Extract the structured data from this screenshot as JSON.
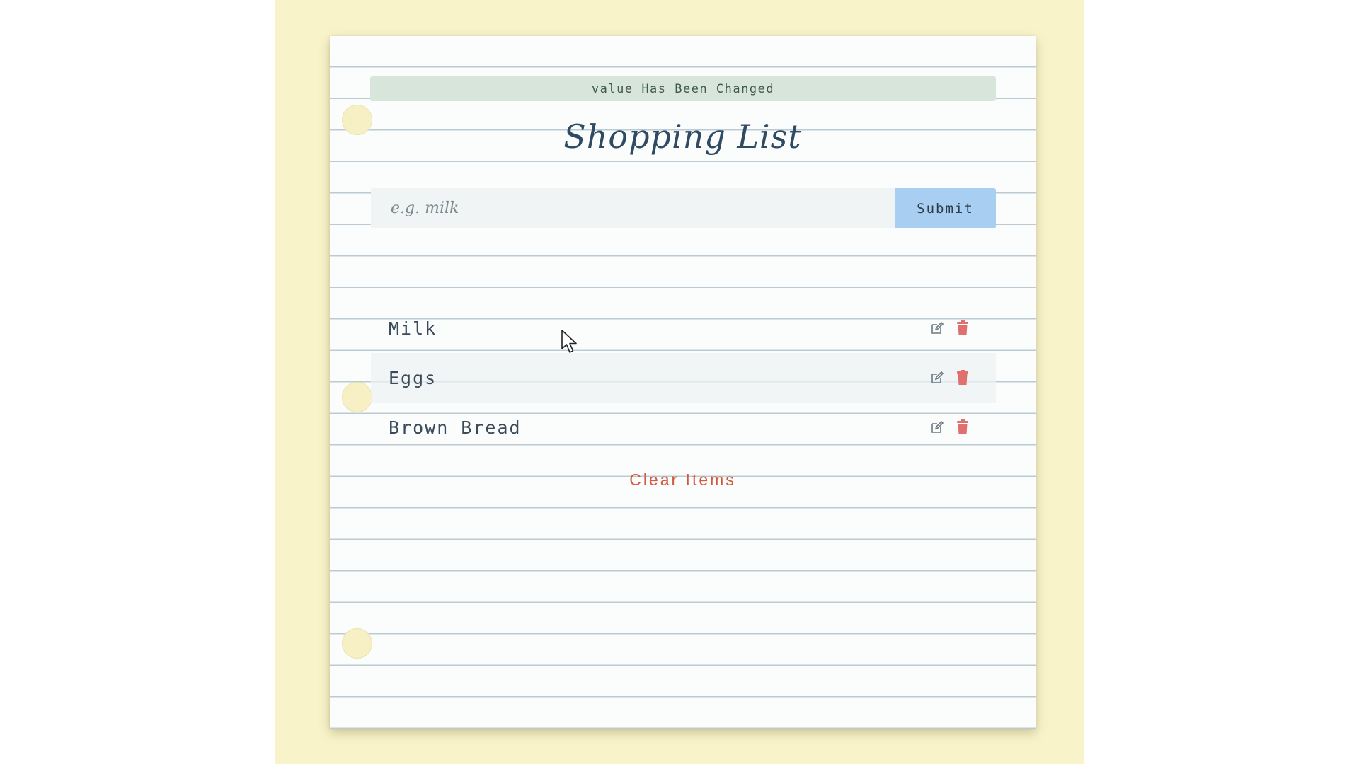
{
  "alert": {
    "text": "value Has Been Changed"
  },
  "header": {
    "title": "Shopping List"
  },
  "form": {
    "placeholder": "e.g. milk",
    "value": "",
    "submit_label": "Submit"
  },
  "items": [
    {
      "name": "Milk"
    },
    {
      "name": "Eggs"
    },
    {
      "name": "Brown Bread"
    }
  ],
  "actions": {
    "clear_label": "Clear Items"
  },
  "icons": {
    "edit": "edit-icon",
    "delete": "trash-icon"
  },
  "colors": {
    "background_strip": "#f8f3c9",
    "alert_bg": "#d8e5da",
    "submit_bg": "#a8cef2",
    "title": "#2f4b63",
    "clear": "#d2583f",
    "delete_icon": "#e07070",
    "edit_icon": "#6b7a82"
  }
}
